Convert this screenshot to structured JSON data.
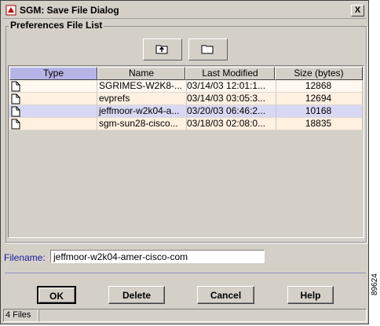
{
  "window": {
    "title": "SGM: Save File Dialog",
    "close_glyph": "X"
  },
  "group": {
    "label": "Preferences File List"
  },
  "toolbar": {
    "icons": [
      "up-folder-icon",
      "new-folder-icon"
    ]
  },
  "table": {
    "columns": [
      "Type",
      "Name",
      "Last Modified",
      "Size (bytes)"
    ],
    "rows": [
      {
        "name": "SGRIMES-W2K8-...",
        "modified": "03/14/03  12:01:1...",
        "size": "12868",
        "selected": false
      },
      {
        "name": "evprefs",
        "modified": "03/14/03  03:05:3...",
        "size": "12694",
        "selected": false
      },
      {
        "name": "jeffmoor-w2k04-a...",
        "modified": "03/20/03  06:46:2...",
        "size": "10168",
        "selected": true
      },
      {
        "name": "sgm-sun28-cisco...",
        "modified": "03/18/03  02:08:0...",
        "size": "18835",
        "selected": false
      }
    ],
    "colors": {
      "odd_row": "#fff8f0",
      "even_row": "#fff0e0",
      "selected_row": "#d8d8f4"
    }
  },
  "filename": {
    "label": "Filename:",
    "value": "jeffmoor-w2k04-amer-cisco-com"
  },
  "buttons": {
    "ok": "OK",
    "delete": "Delete",
    "cancel": "Cancel",
    "help": "Help"
  },
  "status": {
    "text": "4 Files"
  },
  "figure_number": "89624"
}
